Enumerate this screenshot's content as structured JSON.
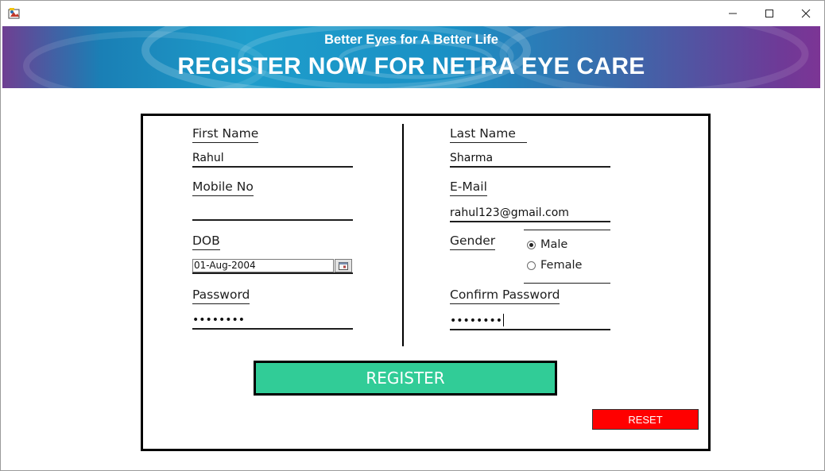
{
  "window": {
    "icon": "java-app-icon",
    "controls": [
      "minimize-icon",
      "maximize-icon",
      "close-icon"
    ]
  },
  "banner": {
    "subtitle": "Better Eyes for A Better Life",
    "title": "REGISTER NOW FOR NETRA EYE CARE"
  },
  "form": {
    "first_name": {
      "label": "First Name",
      "value": "Rahul"
    },
    "last_name": {
      "label": "Last Name",
      "value": "Sharma"
    },
    "mobile": {
      "label": "Mobile No",
      "value": ""
    },
    "email": {
      "label": "E-Mail",
      "value": "rahul123@gmail.com"
    },
    "dob": {
      "label": "DOB",
      "value": "01-Aug-2004",
      "picker_icon": "calendar-icon"
    },
    "gender": {
      "label": "Gender",
      "options": [
        {
          "label": "Male",
          "selected": true
        },
        {
          "label": "Female",
          "selected": false
        }
      ]
    },
    "password": {
      "label": "Password",
      "value": "••••••••"
    },
    "confirm_password": {
      "label": "Confirm Password",
      "value": "••••••••"
    }
  },
  "buttons": {
    "register": "REGISTER",
    "reset": "RESET"
  },
  "colors": {
    "register_bg": "#31cc97",
    "reset_bg": "#ff0000",
    "banner_left": "#1a7fb5",
    "banner_right": "#7c3595"
  }
}
